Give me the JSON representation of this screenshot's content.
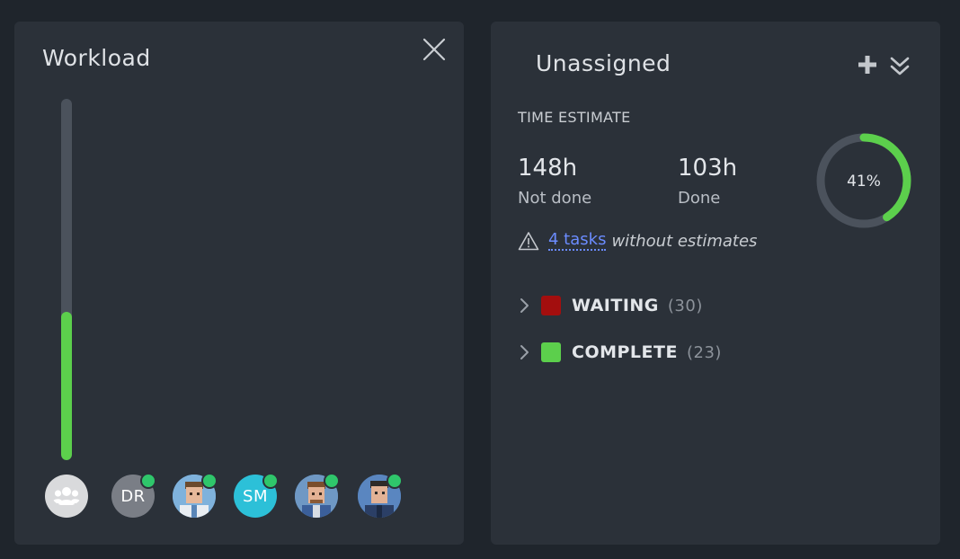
{
  "workload": {
    "title": "Workload",
    "load_fraction": 0.41,
    "colors": {
      "track": "#4b525c",
      "fill": "#5ccf4c"
    },
    "avatars": [
      {
        "type": "group-icon",
        "bg": "#d9dadc"
      },
      {
        "type": "initials",
        "initials": "DR",
        "bg": "#7a7e86",
        "online": true
      },
      {
        "type": "photo",
        "bg": "#6a9fd0",
        "online": true
      },
      {
        "type": "initials",
        "initials": "SM",
        "bg": "#2cc0d8",
        "online": true
      },
      {
        "type": "photo",
        "bg": "#4f83b8",
        "online": true
      },
      {
        "type": "photo",
        "bg": "#3c6aa6",
        "online": true
      }
    ]
  },
  "unassigned": {
    "title": "Unassigned",
    "time_estimate_label": "TIME ESTIMATE",
    "not_done": {
      "value": "148h",
      "label": "Not done"
    },
    "done": {
      "value": "103h",
      "label": "Done"
    },
    "progress": {
      "percent": 41,
      "label": "41%",
      "fill_color": "#5ccf4c",
      "track_color": "#4b525c"
    },
    "warning": {
      "link_text": "4 tasks",
      "suffix": "without estimates"
    },
    "statuses": [
      {
        "name": "WAITING",
        "count": "(30)",
        "color": "#a30e0e"
      },
      {
        "name": "COMPLETE",
        "count": "(23)",
        "color": "#5ccf4c"
      }
    ]
  }
}
